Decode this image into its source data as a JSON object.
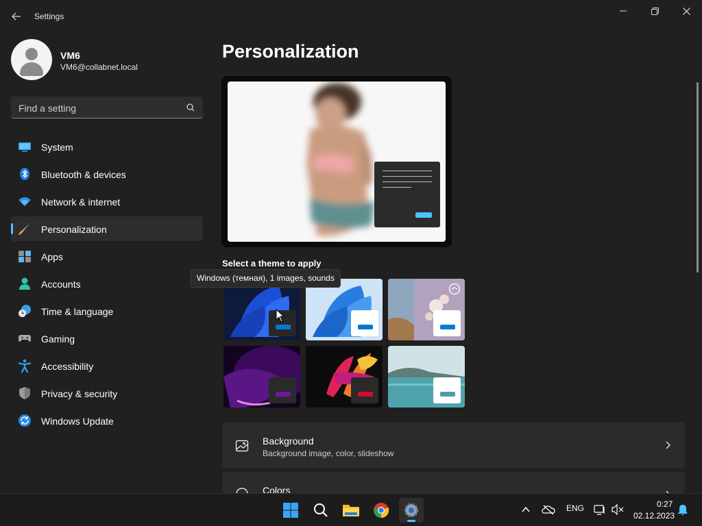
{
  "window": {
    "title": "Settings",
    "back_icon": "arrow-left-icon",
    "controls": [
      "minimize-icon",
      "restore-icon",
      "close-icon"
    ]
  },
  "profile": {
    "name": "VM6",
    "email": "VM6@collabnet.local"
  },
  "search": {
    "placeholder": "Find a setting",
    "icon": "search-icon"
  },
  "nav": {
    "items": [
      {
        "label": "System",
        "icon": "system-icon"
      },
      {
        "label": "Bluetooth & devices",
        "icon": "bluetooth-icon"
      },
      {
        "label": "Network & internet",
        "icon": "wifi-icon"
      },
      {
        "label": "Personalization",
        "icon": "brush-icon",
        "selected": true
      },
      {
        "label": "Apps",
        "icon": "apps-icon"
      },
      {
        "label": "Accounts",
        "icon": "accounts-icon"
      },
      {
        "label": "Time & language",
        "icon": "clock-globe-icon"
      },
      {
        "label": "Gaming",
        "icon": "gamepad-icon"
      },
      {
        "label": "Accessibility",
        "icon": "accessibility-icon"
      },
      {
        "label": "Privacy & security",
        "icon": "shield-icon"
      },
      {
        "label": "Windows Update",
        "icon": "update-icon"
      }
    ]
  },
  "main": {
    "title": "Personalization",
    "theme_section_title": "Select a theme to apply",
    "tooltip": "Windows (темная), 1 images, sounds",
    "themes": [
      {
        "name": "windows-dark-theme",
        "accent": "#0078d4"
      },
      {
        "name": "windows-light-theme",
        "accent": "#0078d4"
      },
      {
        "name": "flowers-theme",
        "accent": "#0e7bd1"
      },
      {
        "name": "glow-theme",
        "accent": "#6b1b9a"
      },
      {
        "name": "captured-motion-theme",
        "accent": "#d30c2a"
      },
      {
        "name": "sunrise-lake-theme",
        "accent": "#4a9fa6"
      }
    ],
    "cards": [
      {
        "title": "Background",
        "subtitle": "Background image, color, slideshow",
        "icon": "image-icon"
      },
      {
        "title": "Colors",
        "subtitle": "",
        "icon": "palette-icon"
      }
    ]
  },
  "taskbar": {
    "apps": [
      "windows-start-icon",
      "search-icon",
      "file-explorer-icon",
      "chrome-icon",
      "settings-icon"
    ],
    "tray": {
      "language": "ENG",
      "time": "0:27",
      "date": "02.12.2023"
    }
  },
  "colors": {
    "accent": "#4cc2ff",
    "background": "#202020"
  }
}
